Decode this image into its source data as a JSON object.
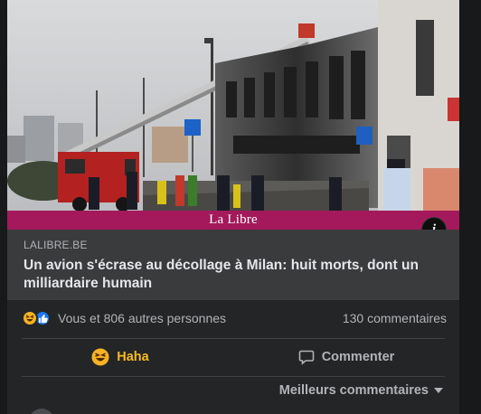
{
  "article": {
    "image_alt": "photo of the crash site in Milan",
    "brand": "La Libre",
    "domain": "LALIBRE.BE",
    "title": "Un avion s'écrase au décollage à Milan: huit morts, dont un milliardaire humain"
  },
  "reactions": {
    "icons": [
      "haha-emoji",
      "like-thumb"
    ],
    "summary": "Vous et 806 autres personnes",
    "comments": "130 commentaires"
  },
  "actions": {
    "haha_label": "Haha",
    "comment_label": "Commenter"
  },
  "sort": {
    "label": "Meilleurs commentaires"
  },
  "colors": {
    "brand_bar": "#a3195b",
    "haha": "#f7b928",
    "like": "#1877f2",
    "card": "#242526"
  }
}
